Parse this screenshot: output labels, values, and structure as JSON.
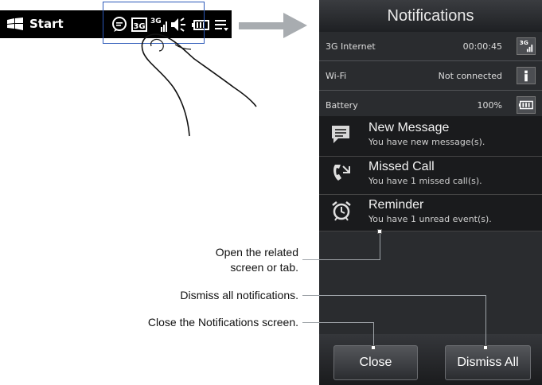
{
  "taskbar": {
    "start_label": "Start"
  },
  "phone": {
    "title": "Notifications",
    "status": [
      {
        "name": "3G Internet",
        "value": "00:00:45",
        "icon": "3g-signal-icon"
      },
      {
        "name": "Wi-Fi",
        "value": "Not connected",
        "icon": "wifi-icon"
      },
      {
        "name": "Battery",
        "value": "100%",
        "icon": "battery-icon"
      }
    ],
    "notifications": [
      {
        "title": "New Message",
        "subtitle": "You have new message(s).",
        "icon": "message-icon"
      },
      {
        "title": "Missed Call",
        "subtitle": "You have 1 missed call(s).",
        "icon": "missed-call-icon"
      },
      {
        "title": "Reminder",
        "subtitle": "You have 1 unread event(s).",
        "icon": "alarm-clock-icon"
      }
    ],
    "buttons": {
      "close": "Close",
      "dismiss_all": "Dismiss All"
    }
  },
  "callouts": {
    "open_line1": "Open the related",
    "open_line2": "screen or tab.",
    "dismiss": "Dismiss all notifications.",
    "close": "Close the Notifications screen."
  },
  "colors": {
    "phone_bg": "#2a2c2f",
    "highlight_border": "#2b58b8"
  }
}
